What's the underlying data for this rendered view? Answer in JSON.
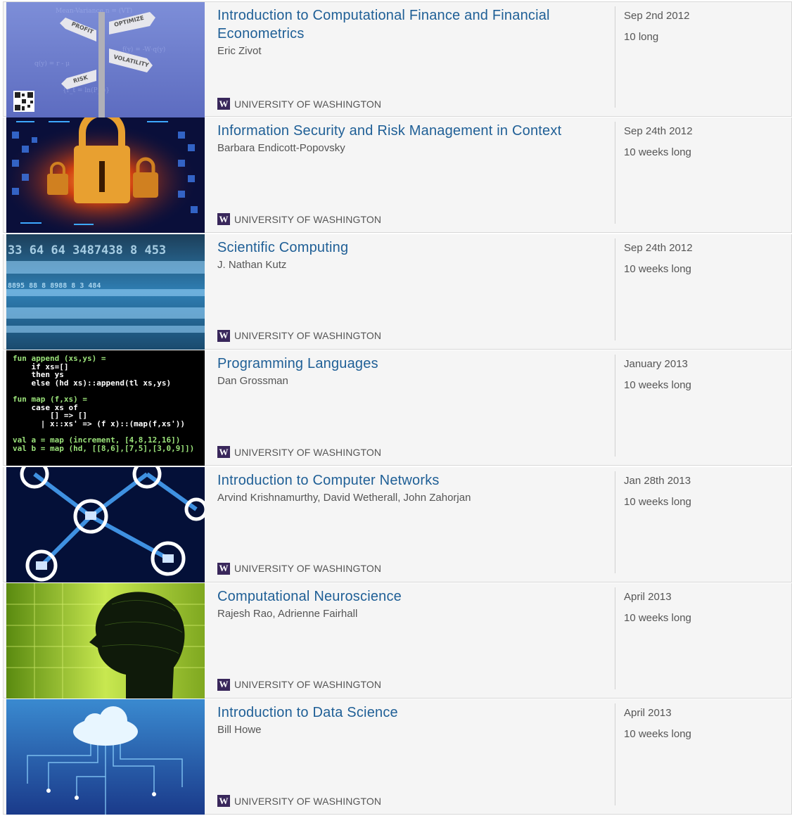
{
  "courses": [
    {
      "title": "Introduction to Computational Finance and Financial Econometrics",
      "instructors": "Eric Zivot",
      "university": "UNIVERSITY OF WASHINGTON",
      "date": "Sep 2nd 2012",
      "duration": "10 long",
      "image": "finance-signpost-image",
      "labels": [
        "PROFIT",
        "OPTIMIZE",
        "VOLATILITY",
        "RISK"
      ]
    },
    {
      "title": "Information Security and Risk Management in Context",
      "instructors": "Barbara Endicott-Popovsky",
      "university": "UNIVERSITY OF WASHINGTON",
      "date": "Sep 24th 2012",
      "duration": "10 weeks long",
      "image": "padlock-image"
    },
    {
      "title": "Scientific Computing",
      "instructors": "J. Nathan Kutz",
      "university": "UNIVERSITY OF WASHINGTON",
      "date": "Sep 24th 2012",
      "duration": "10 weeks long",
      "image": "digital-numbers-image",
      "texts": [
        "33 64 64 3487438 8 453",
        "8895 88 8 8988 8 3 484"
      ]
    },
    {
      "title": "Programming Languages",
      "instructors": "Dan Grossman",
      "university": "UNIVERSITY OF WASHINGTON",
      "date": "January 2013",
      "duration": "10 weeks long",
      "image": "sml-code-image",
      "code": [
        "fun append (xs,ys) =",
        "    if xs=[]",
        "    then ys",
        "    else (hd xs)::append(tl xs,ys)",
        "",
        "fun map (f,xs) =",
        "    case xs of",
        "        [] => []",
        "      | x::xs' => (f x)::(map(f,xs'))",
        "",
        "val a = map (increment, [4,8,12,16])",
        "val b = map (hd, [[8,6],[7,5],[3,0,9]])"
      ]
    },
    {
      "title": "Introduction to Computer Networks",
      "instructors": "Arvind Krishnamurthy, David Wetherall, John Zahorjan",
      "university": "UNIVERSITY OF WASHINGTON",
      "date": "Jan 28th 2013",
      "duration": "10 weeks long",
      "image": "network-nodes-image"
    },
    {
      "title": "Computational Neuroscience",
      "instructors": "Rajesh Rao, Adrienne Fairhall",
      "university": "UNIVERSITY OF WASHINGTON",
      "date": "April 2013",
      "duration": "10 weeks long",
      "image": "wireframe-head-image"
    },
    {
      "title": "Introduction to Data Science",
      "instructors": "Bill Howe",
      "university": "UNIVERSITY OF WASHINGTON",
      "date": "April 2013",
      "duration": "10 weeks long",
      "image": "cloud-circuit-image"
    }
  ],
  "uw_logo_letter": "W",
  "colors": {
    "title": "#1f5f96",
    "text": "#555555",
    "row_bg": "#f5f5f5",
    "uw_purple": "#39275b"
  }
}
